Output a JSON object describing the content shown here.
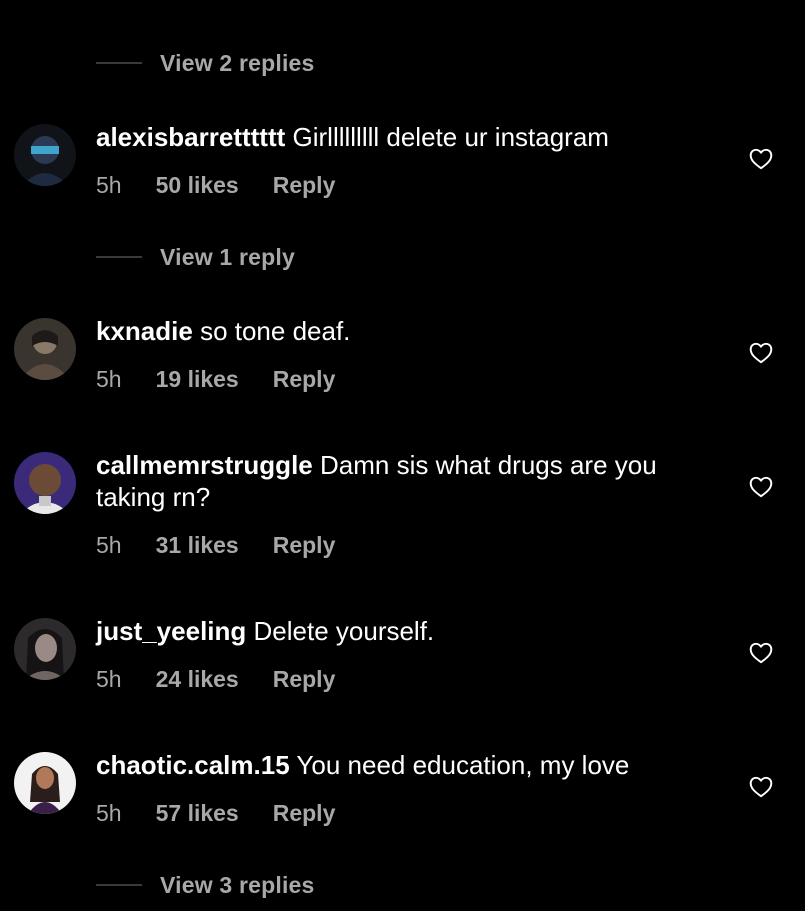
{
  "top_replies": {
    "label": "View 2 replies"
  },
  "comments": [
    {
      "username": "alexisbarretttttt",
      "text": "Girlllllllll delete ur instagram",
      "time": "5h",
      "likes": "50 likes",
      "reply": "Reply",
      "liked": false
    },
    {
      "username": "kxnadie",
      "text": "so tone deaf.",
      "time": "5h",
      "likes": "19 likes",
      "reply": "Reply",
      "liked": false
    },
    {
      "username": "callmemrstruggle",
      "text": "Damn sis what drugs are you taking rn?",
      "time": "5h",
      "likes": "31 likes",
      "reply": "Reply",
      "liked": false
    },
    {
      "username": "just_yeeling",
      "text": "Delete yourself.",
      "time": "5h",
      "likes": "24 likes",
      "reply": "Reply",
      "liked": false
    },
    {
      "username": "chaotic.calm.15",
      "text": "You need education, my love",
      "time": "5h",
      "likes": "57 likes",
      "reply": "Reply",
      "liked": false
    }
  ],
  "view_replies": [
    {
      "label": "View 1 reply"
    },
    {
      "label": "View 3 replies"
    }
  ],
  "icons": {
    "heart": "heart-outline-icon"
  },
  "colors": {
    "background": "#000000",
    "primary_text": "#ffffff",
    "secondary_text": "#a8a8a8",
    "divider_line": "#3a3a3c"
  }
}
